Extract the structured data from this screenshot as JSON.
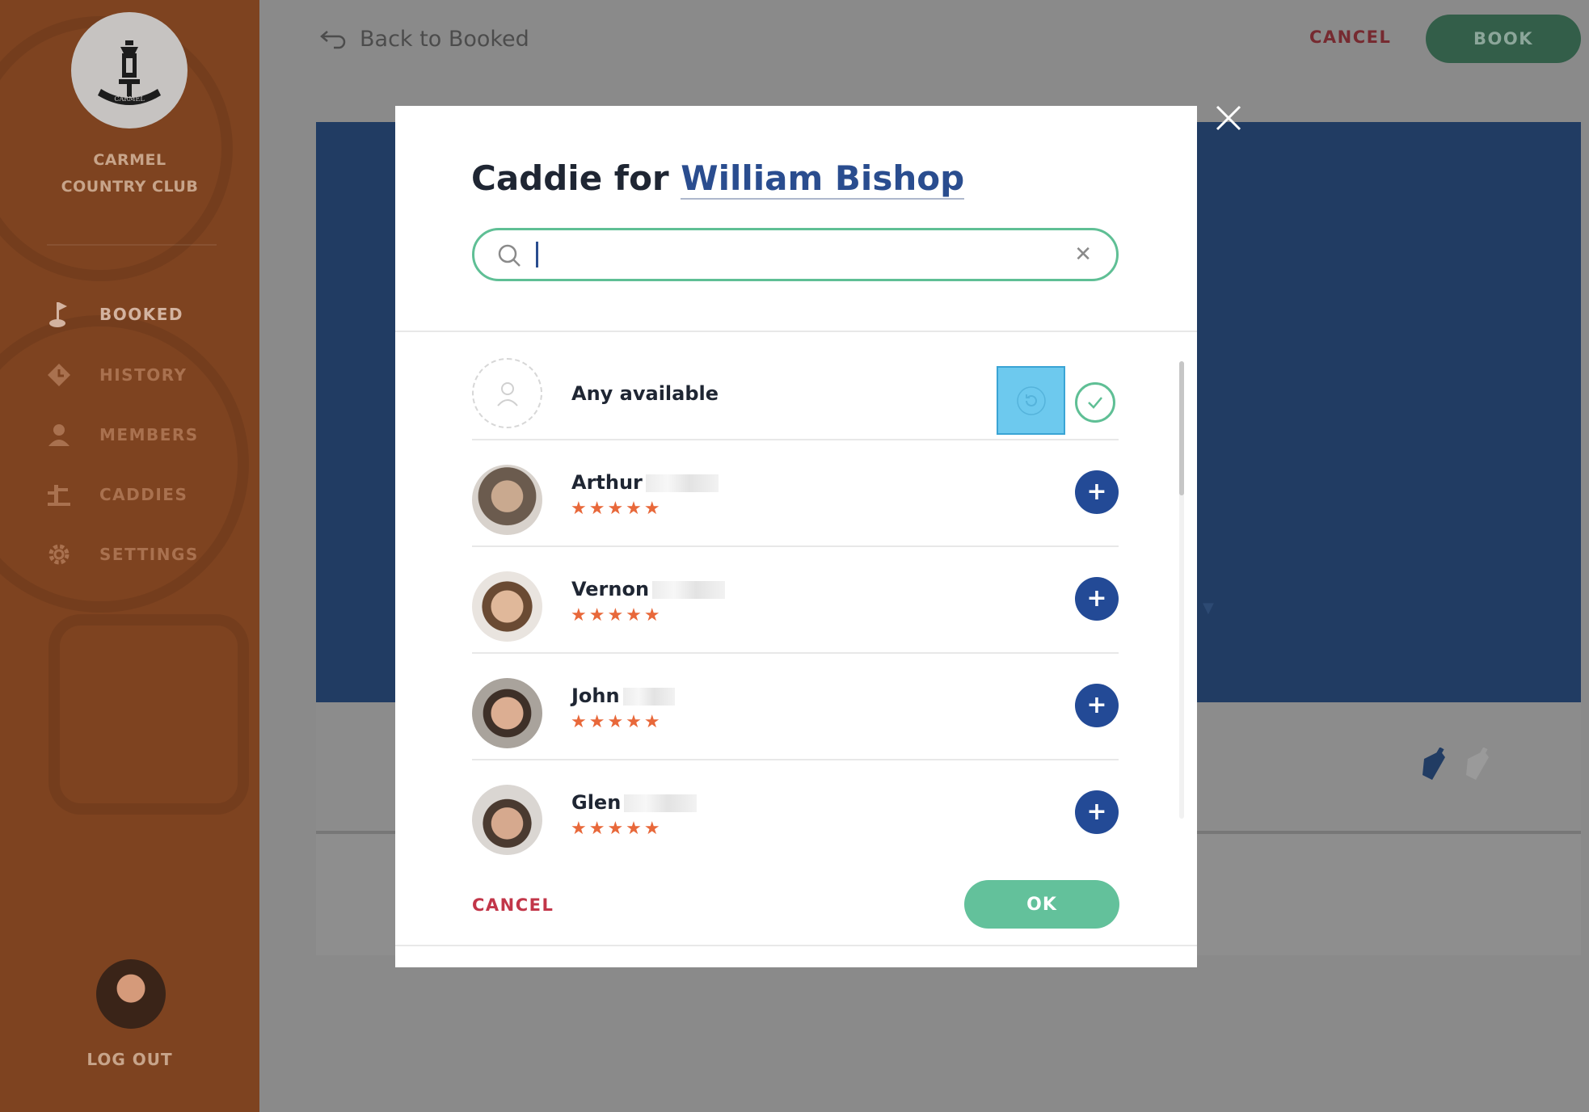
{
  "sidebar": {
    "club_name_line1": "CARMEL",
    "club_name_line2": "COUNTRY CLUB",
    "logo_text": "CARMEL",
    "items": [
      {
        "label": "BOOKED",
        "icon": "golf-flag-icon"
      },
      {
        "label": "HISTORY",
        "icon": "history-tag-icon"
      },
      {
        "label": "MEMBERS",
        "icon": "member-icon"
      },
      {
        "label": "CADDIES",
        "icon": "caddie-icon"
      },
      {
        "label": "SETTINGS",
        "icon": "gear-icon"
      }
    ],
    "logout_label": "LOG OUT"
  },
  "topbar": {
    "back_label": "Back to Booked",
    "cancel_label": "CANCEL",
    "book_label": "BOOK"
  },
  "modal": {
    "title_prefix": "Caddie for",
    "title_name": "William Bishop",
    "search": {
      "value": "",
      "placeholder": ""
    },
    "any_available_label": "Any available",
    "caddies": [
      {
        "first_name": "Arthur",
        "rating": "★★★★★"
      },
      {
        "first_name": "Vernon",
        "rating": "★★★★★"
      },
      {
        "first_name": "John",
        "rating": "★★★★★"
      },
      {
        "first_name": "Glen",
        "rating": "★★★★★"
      }
    ],
    "add_symbol": "+",
    "cancel_label": "CANCEL",
    "ok_label": "OK"
  },
  "colors": {
    "sidebar": "#7e4320",
    "accent_green": "#5fbf95",
    "accent_blue": "#234a96",
    "star": "#e8683a",
    "cancel_red": "#c23649"
  }
}
